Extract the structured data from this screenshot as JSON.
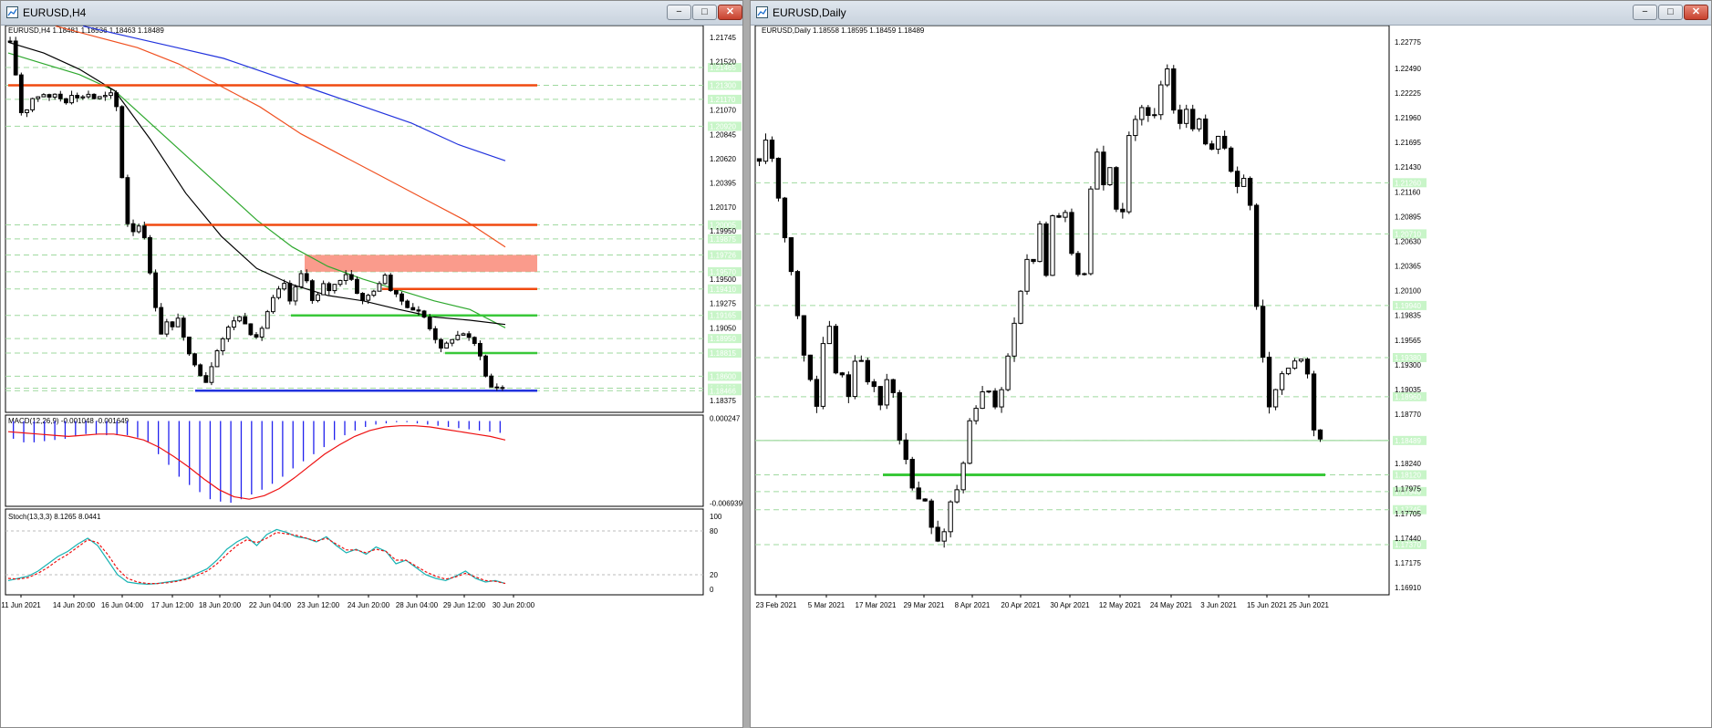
{
  "windows": {
    "left": {
      "title": "EURUSD,H4",
      "ohlc": "EURUSD,H4  1.18481 1.18536 1.18463 1.18489",
      "buttons": {
        "min": "−",
        "max": "□",
        "close": "✕"
      }
    },
    "right": {
      "title": "EURUSD,Daily",
      "ohlc": "EURUSD,Daily  1.18558 1.18595 1.18459 1.18489",
      "buttons": {
        "min": "−",
        "max": "□",
        "close": "✕"
      }
    }
  },
  "colors": {
    "bull": "#ffffff",
    "bear": "#000000",
    "ema_fast": "#000000",
    "ema_mid": "#2ea82e",
    "ema_slow": "#f05020",
    "ema_long": "#2233dd",
    "support_green": "#39c839",
    "resistance": "#f04a10",
    "supply_zone": "#f98a78",
    "macd_hist": "#2222ee",
    "macd_signal": "#ee1111",
    "stoch_main": "#17b3b3",
    "stoch_signal": "#ee1111",
    "price_label_bg": "#c8f5c8",
    "grid": "#9fd99f"
  },
  "chart_data": [
    {
      "id": "h4",
      "type": "candlestick",
      "title": "EURUSD,H4",
      "ylim": [
        1.18265,
        1.21855
      ],
      "x_ticks": [
        "11 Jun 2021",
        "14 Jun 20:00",
        "16 Jun 04:00",
        "17 Jun 12:00",
        "18 Jun 20:00",
        "22 Jun 04:00",
        "23 Jun 12:00",
        "24 Jun 20:00",
        "28 Jun 04:00",
        "29 Jun 12:00",
        "30 Jun 20:00"
      ],
      "y_ticks": [
        "1.21745",
        "1.21520",
        "1.21070",
        "1.20845",
        "1.20620",
        "1.20395",
        "1.20170",
        "1.19950",
        "1.19500",
        "1.19275",
        "1.19050",
        "1.18375"
      ],
      "price_labels": [
        "1.21465",
        "1.21300",
        "1.21170",
        "1.20920",
        "1.20005",
        "1.19875",
        "1.19726",
        "1.19570",
        "1.19410",
        "1.19165",
        "1.18950",
        "1.18815",
        "1.18600",
        "1.18489",
        "1.18466"
      ],
      "close_path": [
        1.217,
        1.214,
        1.2105,
        1.2108,
        1.2118,
        1.212,
        1.2122,
        1.2118,
        1.2122,
        1.2118,
        1.2115,
        1.2122,
        1.2118,
        1.212,
        1.2122,
        1.2118,
        1.2119,
        1.212,
        1.2122,
        1.211,
        1.2045,
        1.2002,
        1.1995,
        1.2,
        1.199,
        1.1955,
        1.1925,
        1.19,
        1.191,
        1.1905,
        1.1915,
        1.1895,
        1.188,
        1.1872,
        1.1862,
        1.1855,
        1.187,
        1.1885,
        1.1895,
        1.1905,
        1.1912,
        1.1915,
        1.191,
        1.19,
        1.1895,
        1.1905,
        1.192,
        1.1932,
        1.194,
        1.1945,
        1.193,
        1.1942,
        1.1955,
        1.195,
        1.193,
        1.1935,
        1.1945,
        1.194,
        1.1945,
        1.195,
        1.1955,
        1.195,
        1.1938,
        1.193,
        1.1935,
        1.194,
        1.1945,
        1.1955,
        1.194,
        1.1935,
        1.193,
        1.1925,
        1.1922,
        1.192,
        1.1915,
        1.1905,
        1.1895,
        1.1885,
        1.189,
        1.1895,
        1.1898,
        1.19,
        1.1895,
        1.189,
        1.188,
        1.186,
        1.185,
        1.185,
        1.1849
      ],
      "levels": [
        {
          "price": 1.213,
          "color": "resistance",
          "style": "solid"
        },
        {
          "price": 1.20005,
          "color": "resistance",
          "style": "solid"
        },
        {
          "price": 1.1941,
          "color": "resistance",
          "style": "solid"
        },
        {
          "price": 1.19165,
          "color": "support_green",
          "style": "solid"
        },
        {
          "price": 1.18815,
          "color": "support_green",
          "style": "solid"
        },
        {
          "price": 1.18466,
          "color": "ema_long",
          "style": "solid"
        }
      ],
      "zone": {
        "from": 1.1957,
        "to": 1.19726
      },
      "ema_fast": [
        1.217,
        1.216,
        1.2145,
        1.2125,
        1.208,
        1.203,
        1.199,
        1.196,
        1.1945,
        1.1935,
        1.193,
        1.1922,
        1.1915,
        1.1912,
        1.1908
      ],
      "ema_mid": [
        1.216,
        1.215,
        1.214,
        1.2125,
        1.2095,
        1.2065,
        1.2035,
        1.2005,
        1.198,
        1.1962,
        1.195,
        1.194,
        1.193,
        1.1922,
        1.1905
      ],
      "ema_slow": [
        1.2185,
        1.2175,
        1.2165,
        1.215,
        1.213,
        1.211,
        1.2085,
        1.2065,
        1.2045,
        1.2025,
        1.2005,
        1.198
      ],
      "ema_long": [
        1.2185,
        1.2175,
        1.2165,
        1.2155,
        1.214,
        1.2125,
        1.211,
        1.2095,
        1.2075,
        1.206
      ],
      "macd": {
        "label": "MACD(12,26,9) -0.001048 -0.001649",
        "y_ticks": [
          "0.000247",
          "-0.006939"
        ],
        "ylim": [
          -0.0072,
          0.0005
        ],
        "hist": [
          -0.0015,
          -0.0018,
          -0.0018,
          -0.0017,
          -0.0016,
          -0.0015,
          -0.0013,
          -0.0011,
          -0.0011,
          -0.0012,
          -0.0012,
          -0.0012,
          -0.0014,
          -0.0018,
          -0.0028,
          -0.0037,
          -0.0047,
          -0.0054,
          -0.006,
          -0.0066,
          -0.0068,
          -0.0069,
          -0.0066,
          -0.0062,
          -0.0058,
          -0.0053,
          -0.0047,
          -0.004,
          -0.0034,
          -0.0028,
          -0.0022,
          -0.0016,
          -0.0012,
          -0.0008,
          -0.0005,
          -0.0003,
          -0.0002,
          -0.0001,
          -0.0001,
          -0.0002,
          -0.0003,
          -0.0004,
          -0.0005,
          -0.0006,
          -0.0007,
          -0.0008,
          -0.0009,
          -0.001
        ],
        "signal": [
          -0.0009,
          -0.001,
          -0.0011,
          -0.0012,
          -0.0013,
          -0.0012,
          -0.0011,
          -0.0011,
          -0.0013,
          -0.0016,
          -0.0022,
          -0.003,
          -0.0039,
          -0.0049,
          -0.0058,
          -0.0064,
          -0.0066,
          -0.0063,
          -0.0057,
          -0.0048,
          -0.0038,
          -0.0028,
          -0.002,
          -0.0013,
          -0.0008,
          -0.0005,
          -0.0004,
          -0.0004,
          -0.0005,
          -0.0007,
          -0.0009,
          -0.0011,
          -0.0013,
          -0.0016
        ]
      },
      "stoch": {
        "label": "Stoch(13,3,3) 8.1265 8.0441",
        "y_ticks": [
          "100",
          "80",
          "20",
          "0"
        ],
        "ylim": [
          0,
          100
        ],
        "main": [
          12,
          15,
          18,
          25,
          35,
          45,
          52,
          62,
          70,
          60,
          40,
          20,
          10,
          8,
          7,
          8,
          10,
          12,
          15,
          22,
          28,
          40,
          55,
          65,
          72,
          60,
          75,
          82,
          78,
          72,
          70,
          65,
          72,
          60,
          50,
          55,
          48,
          58,
          52,
          35,
          40,
          30,
          20,
          15,
          12,
          18,
          25,
          15,
          10,
          12,
          8
        ],
        "signal": [
          15,
          14,
          16,
          22,
          30,
          40,
          48,
          58,
          68,
          64,
          48,
          28,
          15,
          10,
          8,
          8,
          9,
          11,
          14,
          19,
          25,
          35,
          48,
          60,
          68,
          64,
          70,
          78,
          76,
          74,
          70,
          66,
          70,
          62,
          54,
          54,
          50,
          55,
          52,
          40,
          40,
          32,
          24,
          18,
          14,
          17,
          22,
          17,
          12,
          11,
          8
        ]
      }
    },
    {
      "id": "daily",
      "type": "candlestick",
      "title": "EURUSD,Daily",
      "ylim": [
        1.1683,
        1.2295
      ],
      "x_ticks": [
        "23 Feb 2021",
        "5 Mar 2021",
        "17 Mar 2021",
        "29 Mar 2021",
        "8 Apr 2021",
        "20 Apr 2021",
        "30 Apr 2021",
        "12 May 2021",
        "24 May 2021",
        "3 Jun 2021",
        "15 Jun 2021",
        "25 Jun 2021"
      ],
      "y_ticks": [
        "1.22775",
        "1.22490",
        "1.22225",
        "1.21960",
        "1.21695",
        "1.21430",
        "1.21160",
        "1.20895",
        "1.20630",
        "1.20365",
        "1.20100",
        "1.19835",
        "1.19565",
        "1.19300",
        "1.19035",
        "1.18770",
        "1.18240",
        "1.17975",
        "1.17705",
        "1.17440",
        "1.17175",
        "1.16910"
      ],
      "price_labels": [
        "1.21260",
        "1.20710",
        "1.19940",
        "1.19380",
        "1.18960",
        "1.18489",
        "1.18120",
        "1.17940",
        "1.17745",
        "1.17370"
      ],
      "close_path": [
        1.215,
        1.2175,
        1.216,
        1.212,
        1.208,
        1.205,
        1.201,
        1.196,
        1.193,
        1.191,
        1.188,
        1.196,
        1.197,
        1.192,
        1.1925,
        1.189,
        1.192,
        1.196,
        1.191,
        1.1915,
        1.19,
        1.188,
        1.192,
        1.19,
        1.185,
        1.183,
        1.18,
        1.178,
        1.1795,
        1.1765,
        1.174,
        1.174,
        1.176,
        1.179,
        1.1795,
        1.183,
        1.187,
        1.188,
        1.19,
        1.191,
        1.188,
        1.189,
        1.192,
        1.196,
        1.198,
        1.202,
        1.205,
        1.204,
        1.208,
        1.202,
        1.209,
        1.208,
        1.211,
        1.206,
        1.204,
        1.202,
        1.203,
        1.215,
        1.216,
        1.212,
        1.214,
        1.21,
        1.208,
        1.217,
        1.219,
        1.22,
        1.222,
        1.218,
        1.221,
        1.224,
        1.225,
        1.22,
        1.219,
        1.221,
        1.218,
        1.22,
        1.218,
        1.215,
        1.218,
        1.217,
        1.216,
        1.213,
        1.212,
        1.213,
        1.21,
        1.2,
        1.195,
        1.188,
        1.19,
        1.191,
        1.1935,
        1.192,
        1.1945,
        1.193,
        1.192,
        1.1855,
        1.1849
      ],
      "levels": [
        {
          "price": 1.18489,
          "color": "grid",
          "style": "solid"
        },
        {
          "price": 1.1812,
          "color": "support_green",
          "style": "solid"
        }
      ]
    }
  ]
}
